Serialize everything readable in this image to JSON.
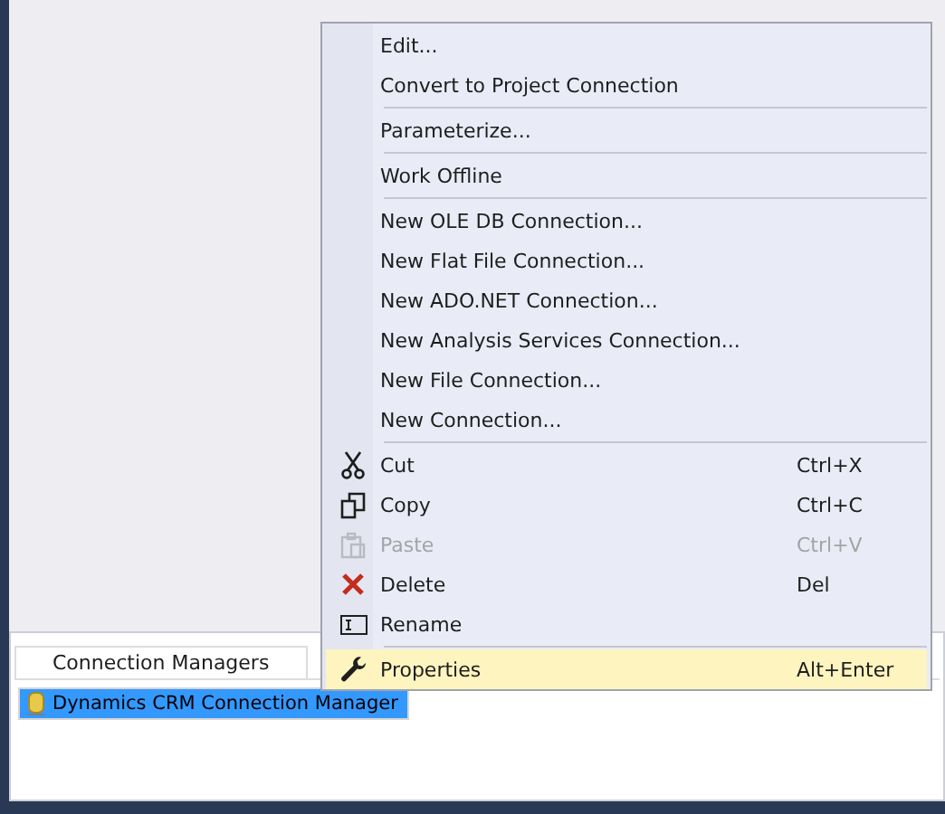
{
  "context_menu": {
    "items": [
      {
        "kind": "item",
        "label": "Edit...",
        "disabled": false,
        "selected": false
      },
      {
        "kind": "item",
        "label": "Convert to Project Connection",
        "disabled": false,
        "selected": false
      },
      {
        "kind": "separator"
      },
      {
        "kind": "item",
        "label": "Parameterize...",
        "disabled": false,
        "selected": false
      },
      {
        "kind": "separator"
      },
      {
        "kind": "item",
        "label": "Work Offline",
        "disabled": false,
        "selected": false
      },
      {
        "kind": "separator"
      },
      {
        "kind": "item",
        "label": "New OLE DB Connection...",
        "disabled": false,
        "selected": false
      },
      {
        "kind": "item",
        "label": "New Flat File Connection...",
        "disabled": false,
        "selected": false
      },
      {
        "kind": "item",
        "label": "New ADO.NET Connection...",
        "disabled": false,
        "selected": false
      },
      {
        "kind": "item",
        "label": "New Analysis Services Connection...",
        "disabled": false,
        "selected": false
      },
      {
        "kind": "item",
        "label": "New File Connection...",
        "disabled": false,
        "selected": false
      },
      {
        "kind": "item",
        "label": "New Connection...",
        "disabled": false,
        "selected": false
      },
      {
        "kind": "separator"
      },
      {
        "kind": "cut",
        "label": "Cut",
        "shortcut": "Ctrl+X",
        "disabled": false,
        "selected": false
      },
      {
        "kind": "copy",
        "label": "Copy",
        "shortcut": "Ctrl+C",
        "disabled": false,
        "selected": false
      },
      {
        "kind": "paste",
        "label": "Paste",
        "shortcut": "Ctrl+V",
        "disabled": true,
        "selected": false
      },
      {
        "kind": "delete",
        "label": "Delete",
        "shortcut": "Del",
        "disabled": false,
        "selected": false
      },
      {
        "kind": "rename",
        "label": "Rename",
        "disabled": false,
        "selected": false
      },
      {
        "kind": "separator"
      },
      {
        "kind": "properties",
        "label": "Properties",
        "shortcut": "Alt+Enter",
        "disabled": false,
        "selected": true
      }
    ]
  },
  "panel": {
    "tabs": [
      {
        "label": "Connection Managers",
        "selected": true
      }
    ],
    "items": [
      {
        "label": "Dynamics CRM Connection Manager",
        "selected": true
      }
    ]
  }
}
